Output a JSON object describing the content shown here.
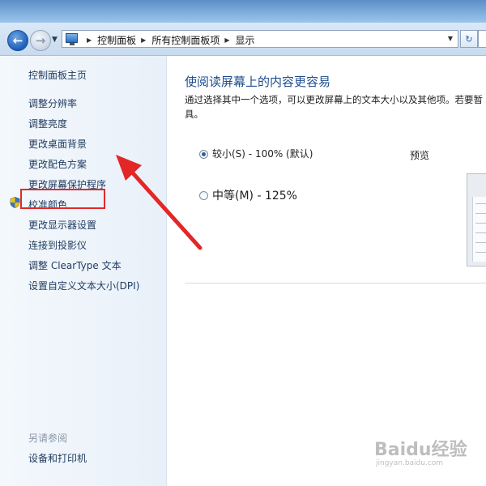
{
  "address_bar": {
    "crumbs": [
      "控制面板",
      "所有控制面板项",
      "显示"
    ]
  },
  "sidebar": {
    "home": "控制面板主页",
    "items": [
      "调整分辨率",
      "调整亮度",
      "更改桌面背景",
      "更改配色方案",
      "更改屏幕保护程序",
      "校准颜色",
      "更改显示器设置",
      "连接到投影仪",
      "调整 ClearType 文本",
      "设置自定义文本大小(DPI)"
    ],
    "highlighted_item": "更改桌面背景",
    "see_also_label": "另请参阅",
    "see_also_items": [
      "设备和打印机"
    ]
  },
  "main": {
    "title": "使阅读屏幕上的内容更容易",
    "description": "通过选择其中一个选项，可以更改屏幕上的文本大小以及其他项。若要暂",
    "description_cont": "具。",
    "options": [
      {
        "label": "较小(S) - 100% (默认)",
        "selected": true
      },
      {
        "label": "中等(M) - 125%",
        "selected": false
      }
    ],
    "preview_label": "预览"
  },
  "watermark": {
    "logo": "Baidu经验",
    "url": "jingyan.baidu.com"
  },
  "colors": {
    "highlight_box": "#e02a2a",
    "arrow": "#e32626",
    "title_blue": "#1e4d8c"
  }
}
